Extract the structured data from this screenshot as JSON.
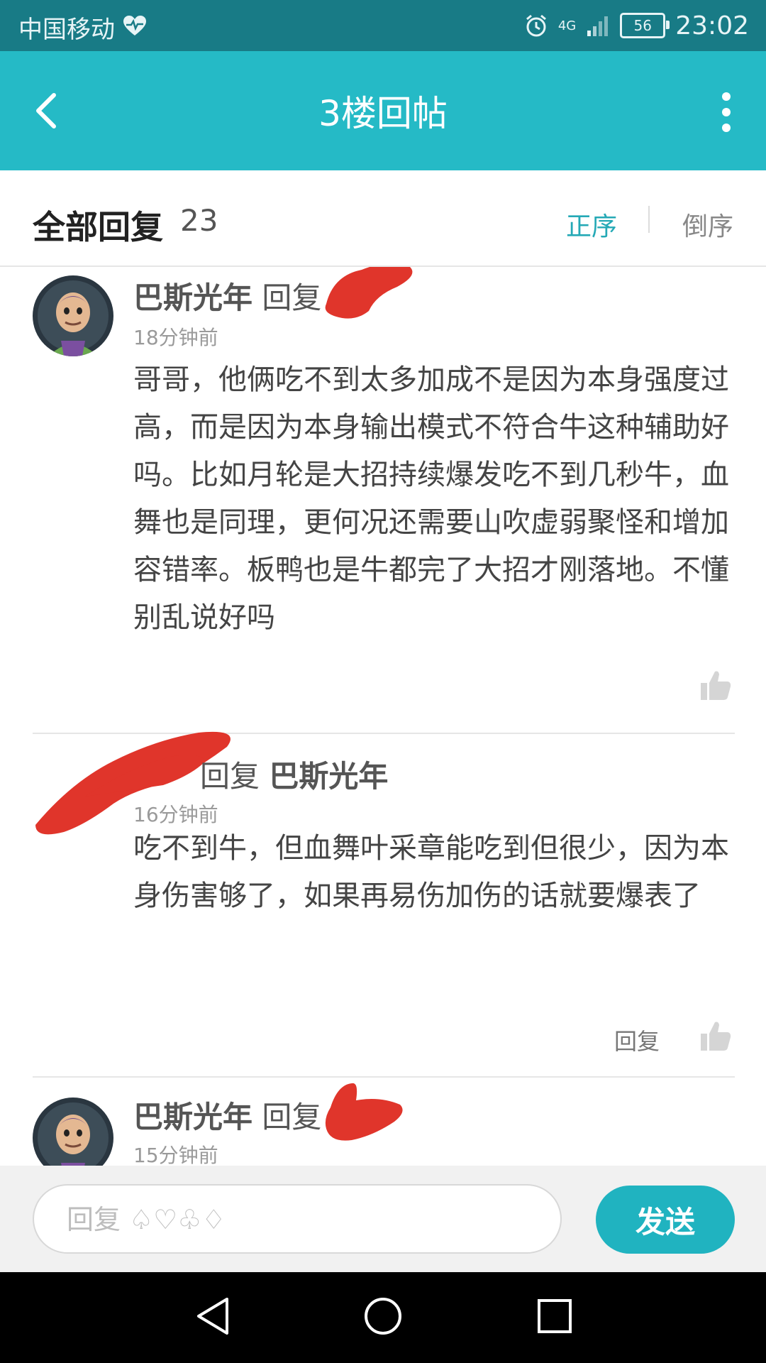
{
  "status_bar": {
    "carrier": "中国移动",
    "network": "4G",
    "battery": "56",
    "time": "23:02"
  },
  "title_bar": {
    "title": "3楼回帖"
  },
  "header": {
    "title": "全部回复",
    "count": "23",
    "sort_asc": "正序",
    "sort_desc": "倒序"
  },
  "comments": [
    {
      "author": "巴斯光年",
      "reply_word": "回复",
      "target": "",
      "time": "18分钟前",
      "content": "哥哥，他俩吃不到太多加成不是因为本身强度过高，而是因为本身输出模式不符合牛这种辅助好吗。比如月轮是大招持续爆发吃不到几秒牛，血舞也是同理，更何况还需要山吹虚弱聚怪和增加容错率。板鸭也是牛都完了大招才刚落地。不懂别乱说好吗"
    },
    {
      "author": "",
      "reply_word": "回复",
      "target": "巴斯光年",
      "time": "16分钟前",
      "content": "吃不到牛，但血舞叶采章能吃到但很少，因为本身伤害够了，如果再易伤加伤的话就要爆表了",
      "reply_label": "回复"
    },
    {
      "author": "巴斯光年",
      "reply_word": "回复",
      "target": "",
      "time": "15分钟前"
    }
  ],
  "input": {
    "placeholder": "回复 ♤♡♧♢",
    "send_label": "发送"
  },
  "colors": {
    "status_bar": "#187b86",
    "title_bar": "#25bac6",
    "accent": "#25a9b6",
    "send_button": "#20b3c0",
    "redaction": "#e0352b"
  }
}
